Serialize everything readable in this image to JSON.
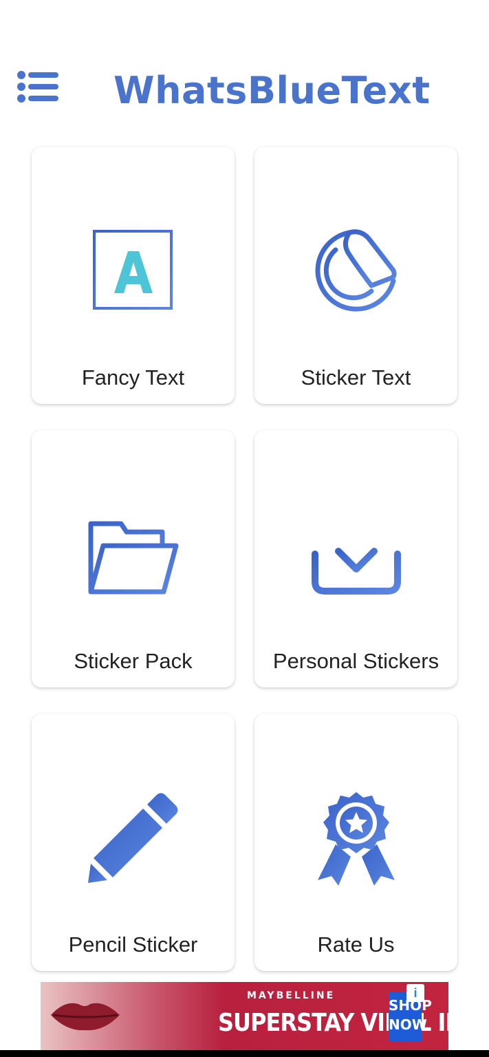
{
  "header": {
    "title": "WhatsBlueText",
    "menu_icon": "list-menu-icon"
  },
  "colors": {
    "brand": "#4a74cc",
    "icon_gradient_start": "#3a63c8",
    "icon_gradient_end": "#5b86e0",
    "letter_accent": "#4ec5d6"
  },
  "cards": [
    {
      "label": "Fancy Text",
      "icon": "letter-a-box-icon"
    },
    {
      "label": "Sticker Text",
      "icon": "peeling-sticker-icon"
    },
    {
      "label": "Sticker Pack",
      "icon": "open-folder-icon"
    },
    {
      "label": "Personal Stickers",
      "icon": "download-icon"
    },
    {
      "label": "Pencil Sticker",
      "icon": "pencil-icon"
    },
    {
      "label": "Rate Us",
      "icon": "award-badge-icon"
    }
  ],
  "ad": {
    "brand": "MAYBELLINE",
    "headline": "SUPERSTAY VINYL INK",
    "cta": "SHOP\nNOW",
    "info": "i"
  }
}
